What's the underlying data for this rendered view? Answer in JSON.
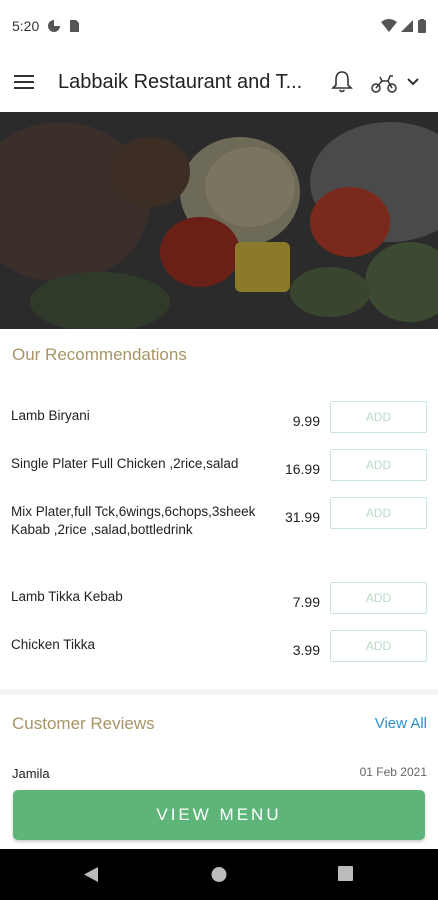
{
  "status_bar": {
    "time": "5:20"
  },
  "app_bar": {
    "title": "Labbaik Restaurant and T..."
  },
  "recommendations": {
    "title": "Our Recommendations",
    "add_label": "ADD",
    "items": [
      {
        "name": "Lamb Biryani",
        "price": "9.99"
      },
      {
        "name": "Single Plater Full Chicken ,2rice,salad",
        "price": "16.99"
      },
      {
        "name": "Mix Plater,full Tck,6wings,6chops,3sheek Kabab ,2rice ,salad,bottledrink",
        "price": "31.99"
      },
      {
        "name": "Lamb Tikka Kebab",
        "price": "7.99"
      },
      {
        "name": "Chicken Tikka",
        "price": "3.99"
      }
    ]
  },
  "reviews": {
    "title": "Customer Reviews",
    "view_all": "View All",
    "first": {
      "name": "Jamila",
      "date": "01 Feb 2021"
    }
  },
  "cta": {
    "label": "VIEW MENU"
  },
  "colors": {
    "accent_green": "#5db57a",
    "section_title": "#a89466",
    "link_blue": "#2d8fc9"
  }
}
